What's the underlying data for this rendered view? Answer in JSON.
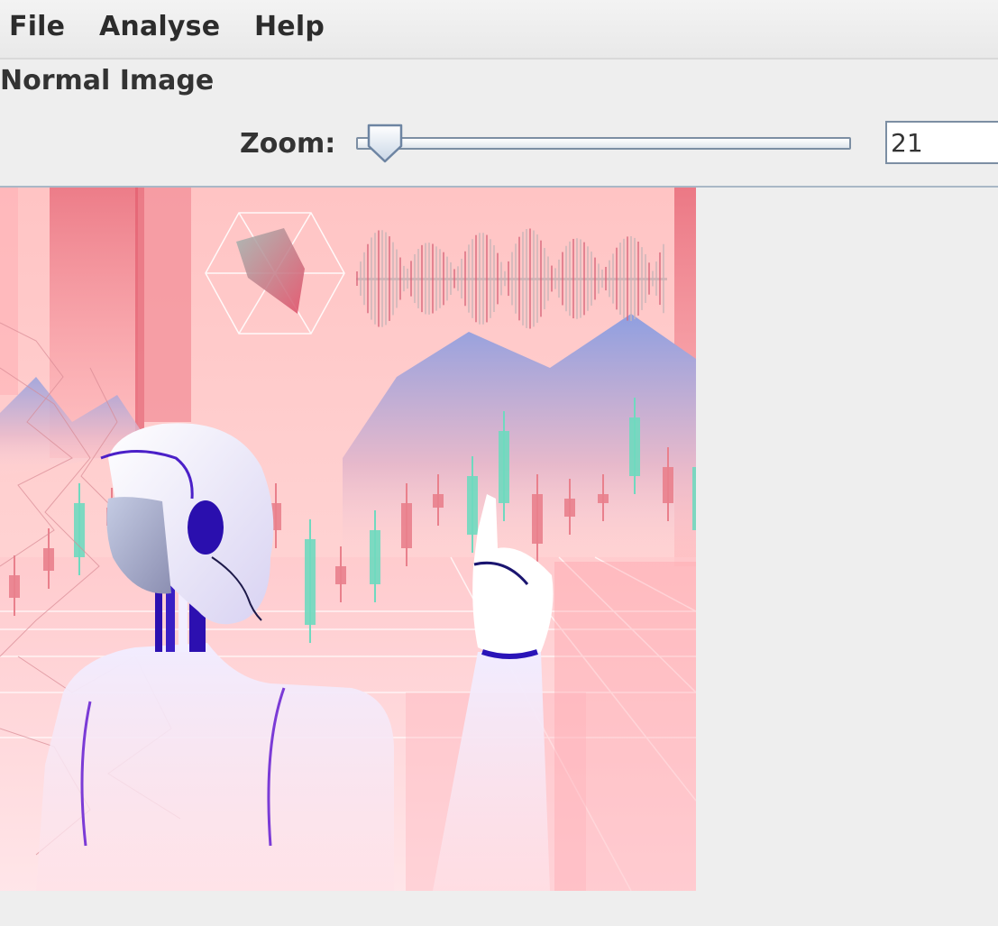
{
  "menu": {
    "file": "File",
    "analyse": "Analyse",
    "help": "Help"
  },
  "panel": {
    "title": "Normal Image"
  },
  "zoom": {
    "label": "Zoom:",
    "value": "21",
    "slider_fraction": 0.03
  },
  "colors": {
    "background": "#eeeeee",
    "image_bg": "#ffc6c6",
    "accent_blue": "#2a14b8",
    "candle_green": "#6fd9bf",
    "candle_red": "#e9808c",
    "mountain": "#9aa3dc"
  }
}
